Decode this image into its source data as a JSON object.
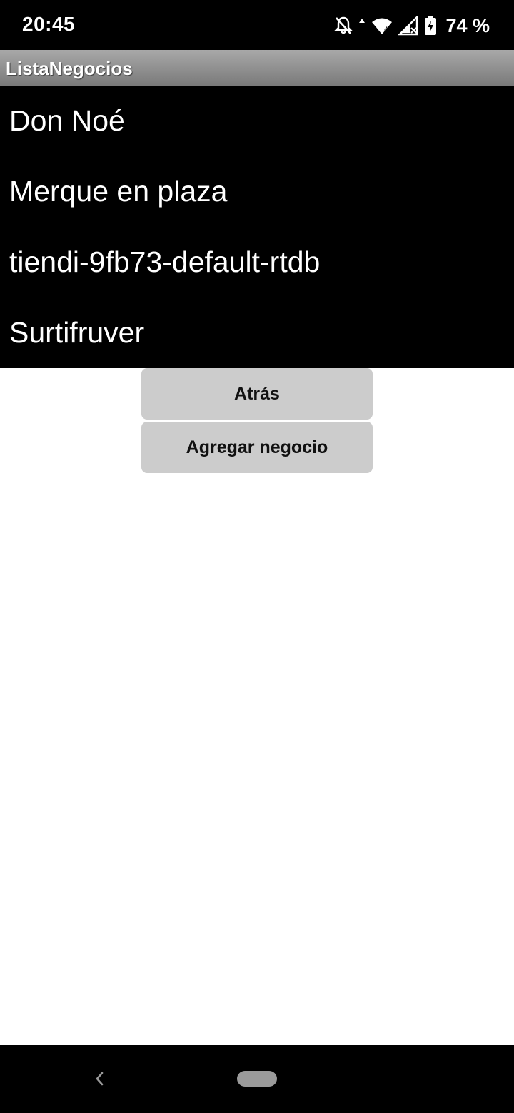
{
  "status_bar": {
    "time": "20:45",
    "battery": "74 %",
    "icons": [
      "bell-off-icon",
      "wifi-icon",
      "signal-icon",
      "battery-charging-icon"
    ]
  },
  "title_bar": {
    "title": "ListaNegocios"
  },
  "list": {
    "items": [
      {
        "label": "Don Noé"
      },
      {
        "label": "Merque en plaza"
      },
      {
        "label": "tiendi-9fb73-default-rtdb"
      },
      {
        "label": "Surtifruver"
      }
    ]
  },
  "buttons": {
    "back_label": "Atrás",
    "add_label": "Agregar negocio"
  },
  "nav_bar": {
    "icons": [
      "back-nav-icon",
      "home-pill-icon"
    ]
  },
  "colors": {
    "status_bar_bg": "#000000",
    "list_bg": "#000000",
    "button_bg": "#cccccc",
    "title_gradient_top": "#a8a8a8",
    "title_gradient_bottom": "#7a7a7a"
  }
}
